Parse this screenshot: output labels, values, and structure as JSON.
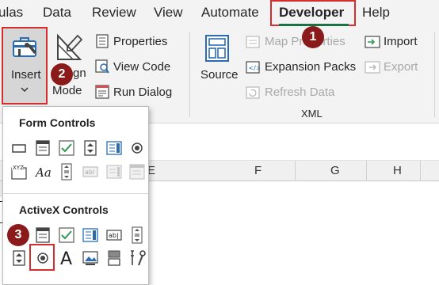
{
  "menu": {
    "items": [
      "ulas",
      "Data",
      "Review",
      "View",
      "Automate",
      "Developer",
      "Help"
    ]
  },
  "ribbon": {
    "insert_label": "Insert",
    "design_mode_label": "Design Mode",
    "design_mode_visible_top": "gn",
    "design_mode_visible_bottom": "Mode",
    "properties": "Properties",
    "view_code": "View Code",
    "run_dialog": "Run Dialog",
    "source": "Source",
    "map_properties": "Map Properties",
    "expansion_packs": "Expansion Packs",
    "refresh_data": "Refresh Data",
    "import": "Import",
    "export": "Export",
    "group_xml": "XML"
  },
  "callouts": [
    "1",
    "2",
    "3"
  ],
  "sheet": {
    "columns": [
      "F",
      "G",
      "H"
    ],
    "cut_column": "E"
  },
  "dropdown": {
    "form_controls_title": "Form Controls",
    "activex_controls_title": "ActiveX Controls",
    "label_glyph": "XYZ",
    "label_aa": "Aa",
    "textbox_glyph": "ab|",
    "label_a": "A"
  },
  "colors": {
    "accent_red": "#d32f2f",
    "callout": "#8b1a1a",
    "developer_underline": "#1e7145",
    "icon_blue": "#2b6cb0",
    "icon_green": "#2e9a55"
  }
}
